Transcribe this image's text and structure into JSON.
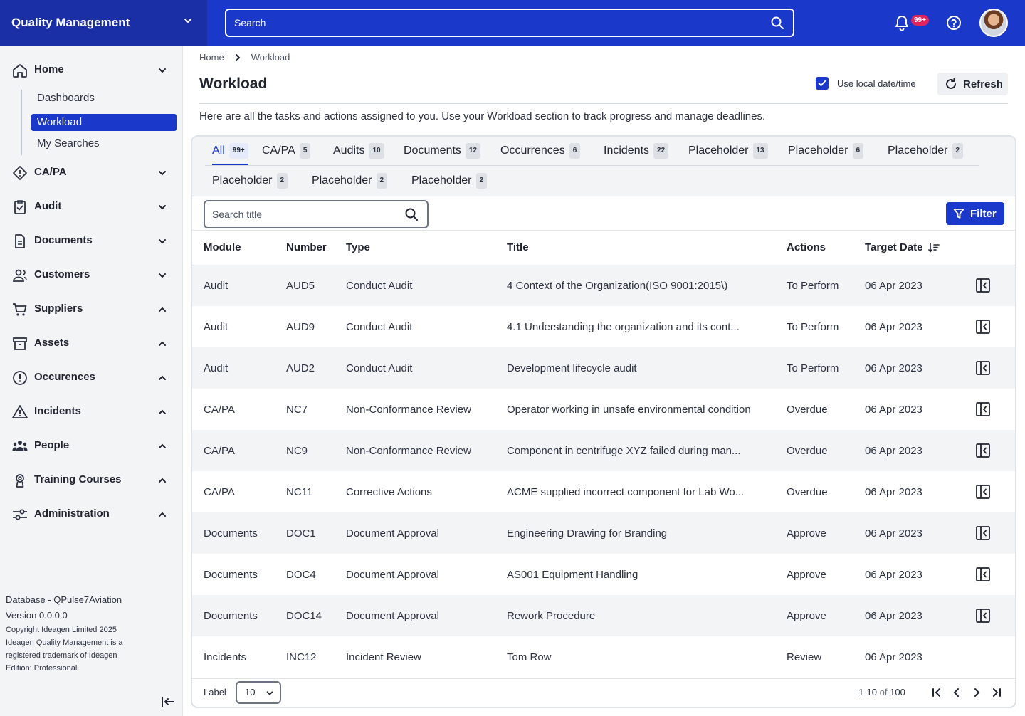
{
  "app": {
    "title": "Quality Management",
    "search_placeholder": "Search",
    "notification_count": "99+"
  },
  "sidebar": {
    "items": [
      {
        "label": "Home",
        "icon": "home-icon",
        "expanded": true
      },
      {
        "label": "CA/PA",
        "icon": "diamond-icon"
      },
      {
        "label": "Audit",
        "icon": "clipboard-check-icon"
      },
      {
        "label": "Documents",
        "icon": "document-icon"
      },
      {
        "label": "Customers",
        "icon": "users-icon"
      },
      {
        "label": "Suppliers",
        "icon": "cart-icon"
      },
      {
        "label": "Assets",
        "icon": "archive-box-icon"
      },
      {
        "label": "Occurences",
        "icon": "alert-circle-icon"
      },
      {
        "label": "Incidents",
        "icon": "warning-triangle-icon"
      },
      {
        "label": "People",
        "icon": "people-group-icon"
      },
      {
        "label": "Training Courses",
        "icon": "award-icon"
      },
      {
        "label": "Administration",
        "icon": "sliders-icon"
      }
    ],
    "home_subitems": [
      "Dashboards",
      "Workload",
      "My Searches"
    ],
    "active_subitem": "Workload",
    "footer": {
      "database": "Database - QPulse7Aviation",
      "version": "Version 0.0.0.0",
      "copyright": "Copyright Ideagen Limited 2025",
      "trademark1": "Ideagen Quality Management is a",
      "trademark2": "registered trademark of Ideagen",
      "edition": "Edition: Professional"
    }
  },
  "breadcrumb": {
    "home": "Home",
    "current": "Workload"
  },
  "page": {
    "title": "Workload",
    "use_local_label": "Use local date/time",
    "use_local_checked": true,
    "refresh_label": "Refresh",
    "description": "Here are all the tasks and actions assigned to you. Use your Workload section to track progress and manage deadlines."
  },
  "tabs": [
    {
      "label": "All",
      "count": "99+"
    },
    {
      "label": "CA/PA",
      "count": "5"
    },
    {
      "label": "Audits",
      "count": "10"
    },
    {
      "label": "Documents",
      "count": "12"
    },
    {
      "label": "Occurrences",
      "count": "6"
    },
    {
      "label": "Incidents",
      "count": "22"
    },
    {
      "label": "Placeholder",
      "count": "13"
    },
    {
      "label": "Placeholder",
      "count": "6"
    },
    {
      "label": "Placeholder",
      "count": "2"
    },
    {
      "label": "Placeholder",
      "count": "2"
    },
    {
      "label": "Placeholder",
      "count": "2"
    },
    {
      "label": "Placeholder",
      "count": "2"
    }
  ],
  "toolbar": {
    "search_placeholder": "Search title",
    "filter_label": "Filter"
  },
  "table": {
    "columns": [
      "Module",
      "Number",
      "Type",
      "Title",
      "Actions",
      "Target Date"
    ],
    "rows": [
      [
        "Audit",
        "AUD5",
        "Conduct Audit",
        "4 Context of the Organization(ISO 9001:2015\\)",
        "To Perform",
        "06 Apr 2023"
      ],
      [
        "Audit",
        "AUD9",
        "Conduct Audit",
        "4.1 Understanding the organization and its cont...",
        "To Perform",
        "06 Apr 2023"
      ],
      [
        "Audit",
        "AUD2",
        "Conduct Audit",
        "Development lifecycle audit",
        "To Perform",
        "06 Apr 2023"
      ],
      [
        "CA/PA",
        "NC7",
        "Non-Conformance Review",
        "Operator working in unsafe environmental condition",
        "Overdue",
        "06 Apr 2023"
      ],
      [
        "CA/PA",
        "NC9",
        "Non-Conformance Review",
        "Component in centrifuge XYZ failed during man...",
        "Overdue",
        "06 Apr 2023"
      ],
      [
        "CA/PA",
        "NC11",
        "Corrective Actions",
        "ACME supplied incorrect component for Lab Wo...",
        "Overdue",
        "06 Apr 2023"
      ],
      [
        "Documents",
        "DOC1",
        "Document Approval",
        "Engineering Drawing for Branding",
        "Approve",
        "06 Apr 2023"
      ],
      [
        "Documents",
        "DOC4",
        "Document Approval",
        "AS001 Equipment Handling",
        "Approve",
        "06 Apr 2023"
      ],
      [
        "Documents",
        "DOC14",
        "Document Approval",
        "Rework Procedure",
        "Approve",
        "06 Apr 2023"
      ],
      [
        "Incidents",
        "INC12",
        "Incident Review",
        "Tom Row",
        "Review",
        "06 Apr 2023"
      ]
    ]
  },
  "pagination": {
    "label": "Label",
    "page_size": "10",
    "range": "1-10",
    "of": "of",
    "total": "100"
  },
  "colors": {
    "primary": "#1a38c9",
    "brand_dark": "#1a2fa6",
    "badge": "#e0245e",
    "sidebar_bg": "#f3f4f6"
  }
}
